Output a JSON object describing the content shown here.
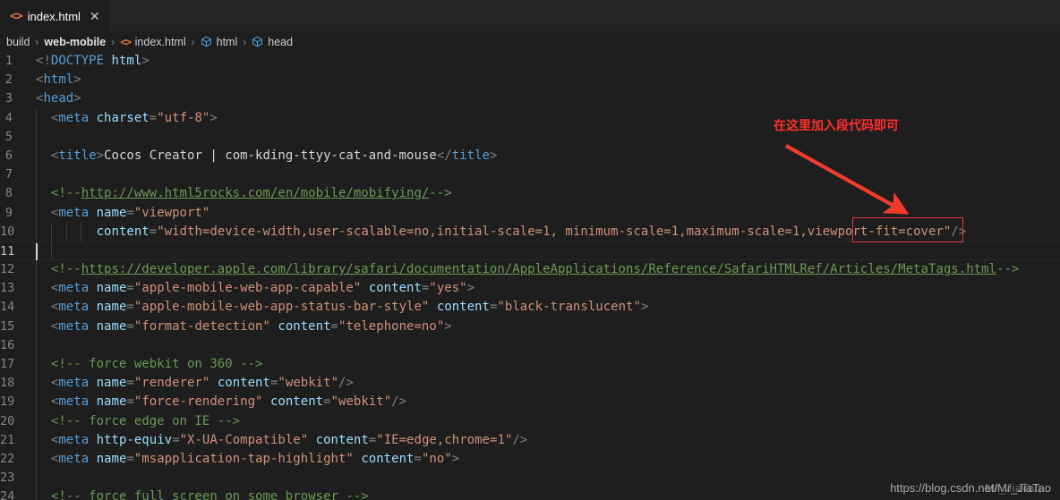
{
  "window": {
    "app": "Visual Studio Code",
    "theme_bg": "#1e1e1e",
    "tabbar_bg": "#252526"
  },
  "tab": {
    "file_icon": "html-file-icon",
    "label": "index.html",
    "close_glyph": "✕"
  },
  "breadcrumb": {
    "items": [
      {
        "label": "build",
        "icon": null,
        "bold": false
      },
      {
        "label": "web-mobile",
        "icon": null,
        "bold": true
      },
      {
        "label": "index.html",
        "icon": "code-icon",
        "bold": false
      },
      {
        "label": "html",
        "icon": "symbol-cube-icon",
        "bold": false
      },
      {
        "label": "head",
        "icon": "symbol-cube-icon",
        "bold": false
      }
    ],
    "separator": "›"
  },
  "annotation": {
    "note_text": "在这里加入段代码即可",
    "note_color": "#ff2d2d",
    "arrow_color": "#f03c2e",
    "box_color": "#e03a3a",
    "box_target": "viewport-fit=cover"
  },
  "watermark": {
    "text": "https://blog.csdn.net/Mr_JiaTao",
    "ghost_text": "Mr_JiaTao"
  },
  "editor": {
    "current_line": 11,
    "language": "html",
    "lines": [
      {
        "n": 1,
        "indent": 0,
        "tokens": [
          {
            "c": "t-punc",
            "t": "<!"
          },
          {
            "c": "t-dt",
            "t": "DOCTYPE"
          },
          {
            "c": "t-plain",
            "t": " "
          },
          {
            "c": "t-dtname",
            "t": "html"
          },
          {
            "c": "t-punc",
            "t": ">"
          }
        ]
      },
      {
        "n": 2,
        "indent": 0,
        "tokens": [
          {
            "c": "t-punc",
            "t": "<"
          },
          {
            "c": "t-tag",
            "t": "html"
          },
          {
            "c": "t-punc",
            "t": ">"
          }
        ]
      },
      {
        "n": 3,
        "indent": 0,
        "tokens": [
          {
            "c": "t-punc",
            "t": "<"
          },
          {
            "c": "t-tag",
            "t": "head"
          },
          {
            "c": "t-punc",
            "t": ">"
          }
        ]
      },
      {
        "n": 4,
        "indent": 1,
        "tokens": [
          {
            "c": "t-punc",
            "t": "  <"
          },
          {
            "c": "t-tag",
            "t": "meta"
          },
          {
            "c": "t-plain",
            "t": " "
          },
          {
            "c": "t-attr",
            "t": "charset"
          },
          {
            "c": "t-punc",
            "t": "="
          },
          {
            "c": "t-str",
            "t": "\"utf-8\""
          },
          {
            "c": "t-punc",
            "t": ">"
          }
        ]
      },
      {
        "n": 5,
        "indent": 1,
        "tokens": []
      },
      {
        "n": 6,
        "indent": 1,
        "tokens": [
          {
            "c": "t-punc",
            "t": "  <"
          },
          {
            "c": "t-tag",
            "t": "title"
          },
          {
            "c": "t-punc",
            "t": ">"
          },
          {
            "c": "t-plain",
            "t": "Cocos Creator | com-kding-ttyy-cat-and-mouse"
          },
          {
            "c": "t-punc",
            "t": "</"
          },
          {
            "c": "t-tag",
            "t": "title"
          },
          {
            "c": "t-punc",
            "t": ">"
          }
        ]
      },
      {
        "n": 7,
        "indent": 1,
        "tokens": []
      },
      {
        "n": 8,
        "indent": 1,
        "tokens": [
          {
            "c": "t-cmt",
            "t": "  <!--"
          },
          {
            "c": "t-link",
            "t": "http://www.html5rocks.com/en/mobile/mobifying/"
          },
          {
            "c": "t-cmt",
            "t": "-->"
          }
        ]
      },
      {
        "n": 9,
        "indent": 1,
        "tokens": [
          {
            "c": "t-punc",
            "t": "  <"
          },
          {
            "c": "t-tag",
            "t": "meta"
          },
          {
            "c": "t-plain",
            "t": " "
          },
          {
            "c": "t-attr",
            "t": "name"
          },
          {
            "c": "t-punc",
            "t": "="
          },
          {
            "c": "t-str",
            "t": "\"viewport\""
          }
        ]
      },
      {
        "n": 10,
        "indent": 4,
        "tokens": [
          {
            "c": "t-plain",
            "t": "        "
          },
          {
            "c": "t-attr",
            "t": "content"
          },
          {
            "c": "t-punc",
            "t": "="
          },
          {
            "c": "t-str",
            "t": "\"width=device-width,user-scalable=no,initial-scale=1, minimum-scale=1,maximum-scale=1,viewport-fit=cover\""
          },
          {
            "c": "t-punc",
            "t": "/>"
          }
        ]
      },
      {
        "n": 11,
        "indent": 2,
        "tokens": []
      },
      {
        "n": 12,
        "indent": 1,
        "tokens": [
          {
            "c": "t-cmt",
            "t": "  <!--"
          },
          {
            "c": "t-link",
            "t": "https://developer.apple.com/library/safari/documentation/AppleApplications/Reference/SafariHTMLRef/Articles/MetaTags.html"
          },
          {
            "c": "t-cmt",
            "t": "-->"
          }
        ]
      },
      {
        "n": 13,
        "indent": 1,
        "tokens": [
          {
            "c": "t-punc",
            "t": "  <"
          },
          {
            "c": "t-tag",
            "t": "meta"
          },
          {
            "c": "t-plain",
            "t": " "
          },
          {
            "c": "t-attr",
            "t": "name"
          },
          {
            "c": "t-punc",
            "t": "="
          },
          {
            "c": "t-str",
            "t": "\"apple-mobile-web-app-capable\""
          },
          {
            "c": "t-plain",
            "t": " "
          },
          {
            "c": "t-attr",
            "t": "content"
          },
          {
            "c": "t-punc",
            "t": "="
          },
          {
            "c": "t-str",
            "t": "\"yes\""
          },
          {
            "c": "t-punc",
            "t": ">"
          }
        ]
      },
      {
        "n": 14,
        "indent": 1,
        "tokens": [
          {
            "c": "t-punc",
            "t": "  <"
          },
          {
            "c": "t-tag",
            "t": "meta"
          },
          {
            "c": "t-plain",
            "t": " "
          },
          {
            "c": "t-attr",
            "t": "name"
          },
          {
            "c": "t-punc",
            "t": "="
          },
          {
            "c": "t-str",
            "t": "\"apple-mobile-web-app-status-bar-style\""
          },
          {
            "c": "t-plain",
            "t": " "
          },
          {
            "c": "t-attr",
            "t": "content"
          },
          {
            "c": "t-punc",
            "t": "="
          },
          {
            "c": "t-str",
            "t": "\"black-translucent\""
          },
          {
            "c": "t-punc",
            "t": ">"
          }
        ]
      },
      {
        "n": 15,
        "indent": 1,
        "tokens": [
          {
            "c": "t-punc",
            "t": "  <"
          },
          {
            "c": "t-tag",
            "t": "meta"
          },
          {
            "c": "t-plain",
            "t": " "
          },
          {
            "c": "t-attr",
            "t": "name"
          },
          {
            "c": "t-punc",
            "t": "="
          },
          {
            "c": "t-str",
            "t": "\"format-detection\""
          },
          {
            "c": "t-plain",
            "t": " "
          },
          {
            "c": "t-attr",
            "t": "content"
          },
          {
            "c": "t-punc",
            "t": "="
          },
          {
            "c": "t-str",
            "t": "\"telephone=no\""
          },
          {
            "c": "t-punc",
            "t": ">"
          }
        ]
      },
      {
        "n": 16,
        "indent": 1,
        "tokens": []
      },
      {
        "n": 17,
        "indent": 1,
        "tokens": [
          {
            "c": "t-cmt",
            "t": "  <!-- force webkit on 360 -->"
          }
        ]
      },
      {
        "n": 18,
        "indent": 1,
        "tokens": [
          {
            "c": "t-punc",
            "t": "  <"
          },
          {
            "c": "t-tag",
            "t": "meta"
          },
          {
            "c": "t-plain",
            "t": " "
          },
          {
            "c": "t-attr",
            "t": "name"
          },
          {
            "c": "t-punc",
            "t": "="
          },
          {
            "c": "t-str",
            "t": "\"renderer\""
          },
          {
            "c": "t-plain",
            "t": " "
          },
          {
            "c": "t-attr",
            "t": "content"
          },
          {
            "c": "t-punc",
            "t": "="
          },
          {
            "c": "t-str",
            "t": "\"webkit\""
          },
          {
            "c": "t-punc",
            "t": "/>"
          }
        ]
      },
      {
        "n": 19,
        "indent": 1,
        "tokens": [
          {
            "c": "t-punc",
            "t": "  <"
          },
          {
            "c": "t-tag",
            "t": "meta"
          },
          {
            "c": "t-plain",
            "t": " "
          },
          {
            "c": "t-attr",
            "t": "name"
          },
          {
            "c": "t-punc",
            "t": "="
          },
          {
            "c": "t-str",
            "t": "\"force-rendering\""
          },
          {
            "c": "t-plain",
            "t": " "
          },
          {
            "c": "t-attr",
            "t": "content"
          },
          {
            "c": "t-punc",
            "t": "="
          },
          {
            "c": "t-str",
            "t": "\"webkit\""
          },
          {
            "c": "t-punc",
            "t": "/>"
          }
        ]
      },
      {
        "n": 20,
        "indent": 1,
        "tokens": [
          {
            "c": "t-cmt",
            "t": "  <!-- force edge on IE -->"
          }
        ]
      },
      {
        "n": 21,
        "indent": 1,
        "tokens": [
          {
            "c": "t-punc",
            "t": "  <"
          },
          {
            "c": "t-tag",
            "t": "meta"
          },
          {
            "c": "t-plain",
            "t": " "
          },
          {
            "c": "t-attr",
            "t": "http-equiv"
          },
          {
            "c": "t-punc",
            "t": "="
          },
          {
            "c": "t-str",
            "t": "\"X-UA-Compatible\""
          },
          {
            "c": "t-plain",
            "t": " "
          },
          {
            "c": "t-attr",
            "t": "content"
          },
          {
            "c": "t-punc",
            "t": "="
          },
          {
            "c": "t-str",
            "t": "\"IE=edge,chrome=1\""
          },
          {
            "c": "t-punc",
            "t": "/>"
          }
        ]
      },
      {
        "n": 22,
        "indent": 1,
        "tokens": [
          {
            "c": "t-punc",
            "t": "  <"
          },
          {
            "c": "t-tag",
            "t": "meta"
          },
          {
            "c": "t-plain",
            "t": " "
          },
          {
            "c": "t-attr",
            "t": "name"
          },
          {
            "c": "t-punc",
            "t": "="
          },
          {
            "c": "t-str",
            "t": "\"msapplication-tap-highlight\""
          },
          {
            "c": "t-plain",
            "t": " "
          },
          {
            "c": "t-attr",
            "t": "content"
          },
          {
            "c": "t-punc",
            "t": "="
          },
          {
            "c": "t-str",
            "t": "\"no\""
          },
          {
            "c": "t-punc",
            "t": ">"
          }
        ]
      },
      {
        "n": 23,
        "indent": 1,
        "tokens": []
      },
      {
        "n": 24,
        "indent": 1,
        "tokens": [
          {
            "c": "t-cmt",
            "t": "  <!-- force full screen on some browser -->"
          }
        ]
      }
    ]
  }
}
